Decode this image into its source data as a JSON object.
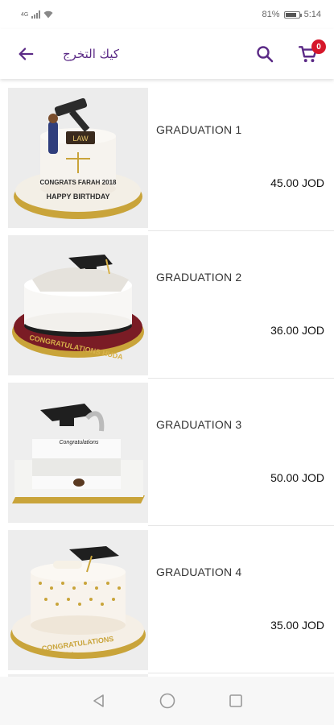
{
  "status_bar": {
    "network": "4G",
    "battery": "81%",
    "battery_level": 0.81,
    "time": "5:14"
  },
  "appbar": {
    "title": "كيك التخرج",
    "cart_count": "0",
    "accent_color": "#5b2a86",
    "badge_color": "#d6172a"
  },
  "products": [
    {
      "name": "GRADUATION 1",
      "price": "45.00  JOD",
      "image": "graduation-cake-law-image"
    },
    {
      "name": "GRADUATION 2",
      "price": "36.00  JOD",
      "image": "graduation-cake-cap-scroll-image"
    },
    {
      "name": "GRADUATION 3",
      "price": "50.00  JOD",
      "image": "graduation-cake-square-image"
    },
    {
      "name": "GRADUATION 4",
      "price": "35.00  JOD",
      "image": "graduation-cake-pearls-image"
    }
  ],
  "icons": {
    "back": "arrow-left-icon",
    "search": "search-icon",
    "cart": "cart-icon",
    "nav_back": "triangle-back-icon",
    "nav_home": "circle-home-icon",
    "nav_recents": "square-recents-icon"
  }
}
